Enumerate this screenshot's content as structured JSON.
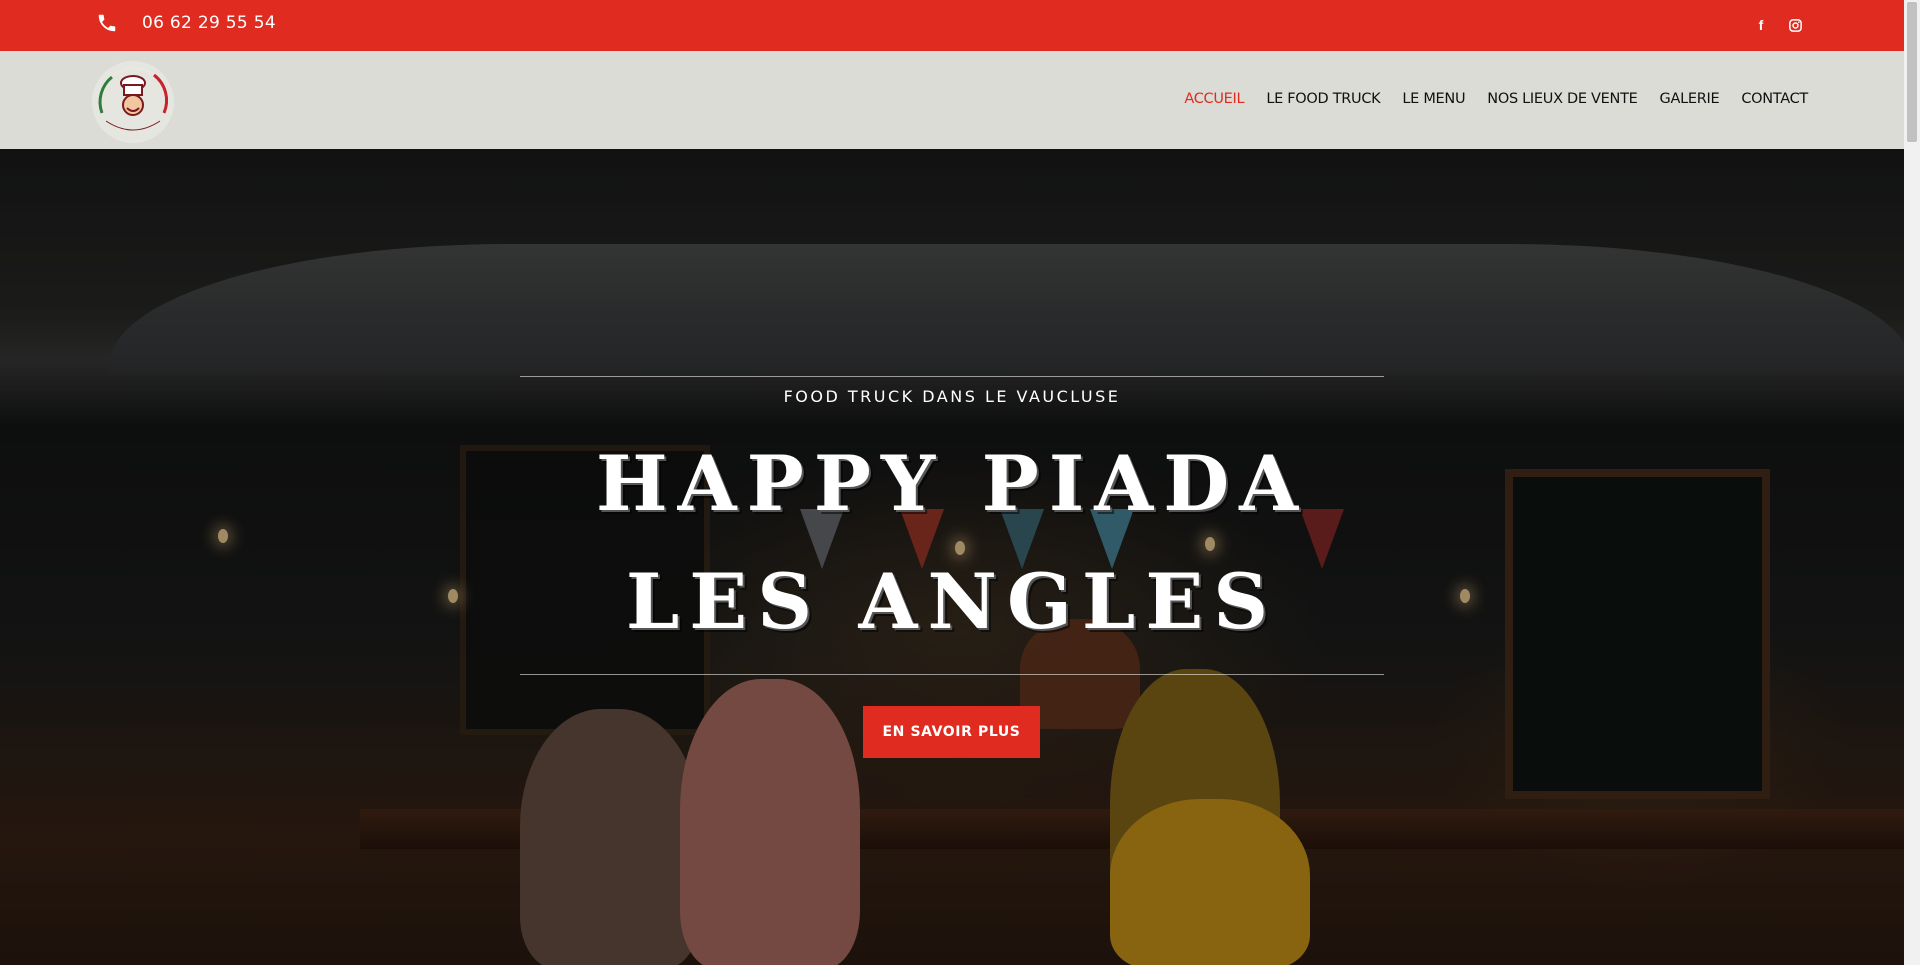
{
  "topbar": {
    "phone_icon": "phone-icon",
    "phone": "06 62 29 55 54",
    "social": {
      "facebook_icon": "facebook-icon",
      "facebook_glyph": "f",
      "instagram_icon": "instagram-icon"
    },
    "bg_color": "#e02b20"
  },
  "header": {
    "logo_text": "HAPPY PIADA",
    "nav": [
      {
        "label": "ACCUEIL",
        "active": true
      },
      {
        "label": "LE FOOD TRUCK",
        "active": false
      },
      {
        "label": "LE MENU",
        "active": false
      },
      {
        "label": "NOS LIEUX DE VENTE",
        "active": false
      },
      {
        "label": "GALERIE",
        "active": false
      },
      {
        "label": "CONTACT",
        "active": false
      }
    ]
  },
  "hero": {
    "tagline": "FOOD TRUCK DANS LE VAUCLUSE",
    "title_line1": "HAPPY PIADA",
    "title_line2": "LES ANGLES",
    "cta_label": "EN SAVOIR PLUS"
  },
  "colors": {
    "accent": "#e02b20",
    "header_bg": "#dcdcd6",
    "nav_text": "#111111"
  }
}
